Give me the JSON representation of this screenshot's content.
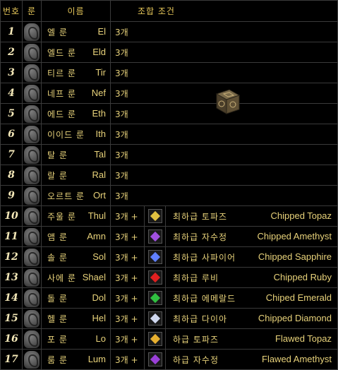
{
  "header": {
    "num": "번호",
    "rune": "룬",
    "name": "이름",
    "condition": "조합 조건"
  },
  "rows": [
    {
      "num": "1",
      "ko": "엘 룬",
      "en": "El",
      "recipe": "3개",
      "has_gem": false
    },
    {
      "num": "2",
      "ko": "엘드 룬",
      "en": "Eld",
      "recipe": "3개",
      "has_gem": false
    },
    {
      "num": "3",
      "ko": "티르 룬",
      "en": "Tir",
      "recipe": "3개",
      "has_gem": false
    },
    {
      "num": "4",
      "ko": "네프 룬",
      "en": "Nef",
      "recipe": "3개",
      "has_gem": false
    },
    {
      "num": "5",
      "ko": "에드 룬",
      "en": "Eth",
      "recipe": "3개",
      "has_gem": false
    },
    {
      "num": "6",
      "ko": "이이드 룬",
      "en": "Ith",
      "recipe": "3개",
      "has_gem": false
    },
    {
      "num": "7",
      "ko": "탈 룬",
      "en": "Tal",
      "recipe": "3개",
      "has_gem": false
    },
    {
      "num": "8",
      "ko": "랄 룬",
      "en": "Ral",
      "recipe": "3개",
      "has_gem": false
    },
    {
      "num": "9",
      "ko": "오르트 룬",
      "en": "Ort",
      "recipe": "3개",
      "has_gem": false
    },
    {
      "num": "10",
      "ko": "주울 룬",
      "en": "Thul",
      "recipe": "3개 +",
      "has_gem": true,
      "gem_ko": "최하급 토파즈",
      "gem_en": "Chipped Topaz",
      "gem_color": "#e0c040"
    },
    {
      "num": "11",
      "ko": "앰 룬",
      "en": "Amn",
      "recipe": "3개 +",
      "has_gem": true,
      "gem_ko": "최하급 자수정",
      "gem_en": "Chipped Amethyst",
      "gem_color": "#a050e0"
    },
    {
      "num": "12",
      "ko": "솔 룬",
      "en": "Sol",
      "recipe": "3개 +",
      "has_gem": true,
      "gem_ko": "최하급 사파이어",
      "gem_en": "Chipped Sapphire",
      "gem_color": "#6080ff"
    },
    {
      "num": "13",
      "ko": "사에 룬",
      "en": "Shael",
      "recipe": "3개 +",
      "has_gem": true,
      "gem_ko": "최하급 루비",
      "gem_en": "Chipped Ruby",
      "gem_color": "#e02020"
    },
    {
      "num": "14",
      "ko": "돌 룬",
      "en": "Dol",
      "recipe": "3개 +",
      "has_gem": true,
      "gem_ko": "최하급 에메랄드",
      "gem_en": "Chiped Emerald",
      "gem_color": "#30c040"
    },
    {
      "num": "15",
      "ko": "헬 룬",
      "en": "Hel",
      "recipe": "3개 +",
      "has_gem": true,
      "gem_ko": "최하급 다이아",
      "gem_en": "Chipped Diamond",
      "gem_color": "#d0d8f0"
    },
    {
      "num": "16",
      "ko": "포 룬",
      "en": "Lo",
      "recipe": "3개 +",
      "has_gem": true,
      "gem_ko": "하급 토파즈",
      "gem_en": "Flawed Topaz",
      "gem_color": "#e8b030"
    },
    {
      "num": "17",
      "ko": "룸 룬",
      "en": "Lum",
      "recipe": "3개 +",
      "has_gem": true,
      "gem_ko": "하급 자수정",
      "gem_en": "Flawed Amethyst",
      "gem_color": "#9a40d8"
    }
  ],
  "icons": {
    "cube": "horadric-cube-icon",
    "rune": "rune-stone-icon",
    "gem": "gem-icon"
  }
}
